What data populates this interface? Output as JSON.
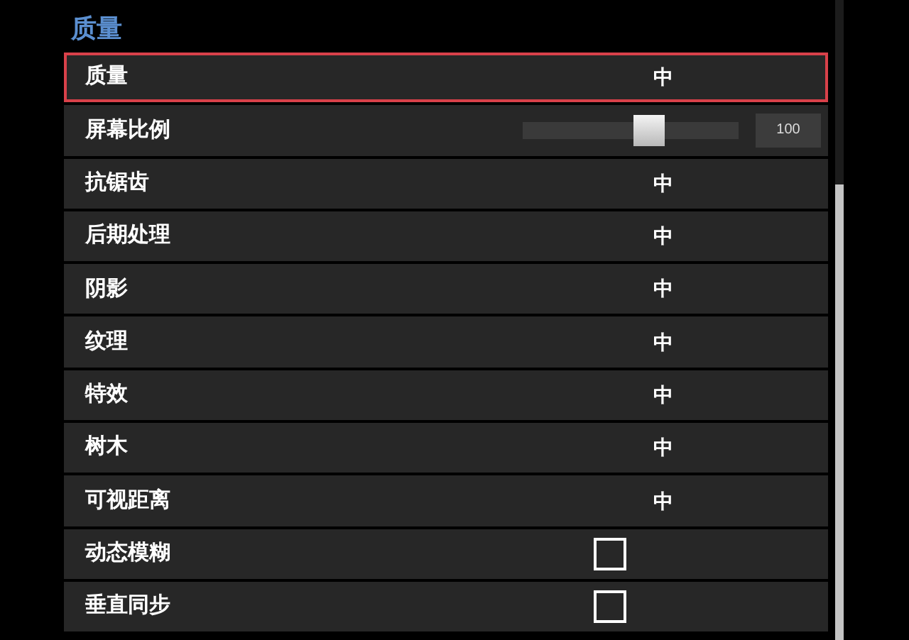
{
  "section_title": "质量",
  "settings": [
    {
      "kind": "option",
      "label": "质量",
      "value": "中",
      "selected": true
    },
    {
      "kind": "slider",
      "label": "屏幕比例",
      "level": 0.6,
      "reading": "100",
      "selected": false
    },
    {
      "kind": "option",
      "label": "抗锯齿",
      "value": "中",
      "selected": false
    },
    {
      "kind": "option",
      "label": "后期处理",
      "value": "中",
      "selected": false
    },
    {
      "kind": "option",
      "label": "阴影",
      "value": "中",
      "selected": false
    },
    {
      "kind": "option",
      "label": "纹理",
      "value": "中",
      "selected": false
    },
    {
      "kind": "option",
      "label": "特效",
      "value": "中",
      "selected": false
    },
    {
      "kind": "option",
      "label": "树木",
      "value": "中",
      "selected": false
    },
    {
      "kind": "option",
      "label": "可视距离",
      "value": "中",
      "selected": false
    },
    {
      "kind": "checkbox",
      "label": "动态模糊",
      "checked": false,
      "selected": false
    },
    {
      "kind": "checkbox",
      "label": "垂直同步",
      "checked": false,
      "selected": false
    }
  ]
}
